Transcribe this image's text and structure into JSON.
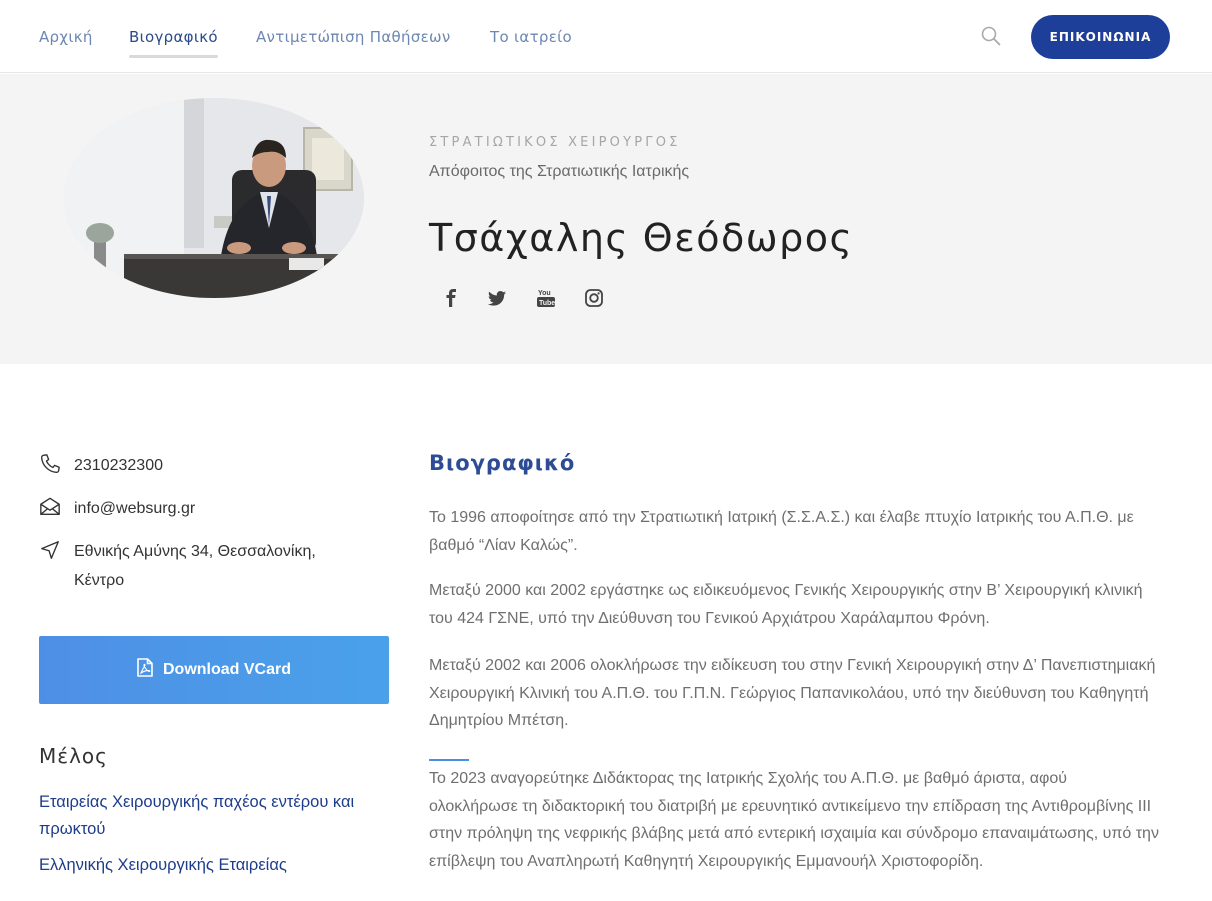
{
  "nav": {
    "items": [
      {
        "label": "Αρχική"
      },
      {
        "label": "Βιογραφικό",
        "active": true
      },
      {
        "label": "Αντιμετώπιση Παθήσεων"
      },
      {
        "label": "Το ιατρείο"
      }
    ],
    "search_icon": "search-icon",
    "contact_label": "ΕΠΙΚΟΙΝΩΝΙΑ",
    "contact_color": "#1d3e99"
  },
  "hero": {
    "portrait_alt": "portrait",
    "caps_subtitle": "ΣΤΡΑΤΙΩΤΙΚΟΣ ΧΕΙΡΟΥΡΓΟΣ",
    "subtitle": "Απόφοιτος της Στρατιωτικής Ιατρικής",
    "name": "Τσάχαλης Θεόδωρος",
    "social": [
      "facebook-icon",
      "twitter-icon",
      "youtube-icon",
      "instagram-icon"
    ]
  },
  "contact": {
    "phone": "2310232300",
    "email": "info@websurg.gr",
    "address": "Εθνικής Αμύνης 34, Θεσσαλονίκη, Κέντρο"
  },
  "vcard": {
    "label": "Download VCard",
    "color_start": "#4e8fe6",
    "color_end": "#4aa1ea"
  },
  "members": {
    "title": "Μέλος",
    "links": [
      "Εταιρείας Χειρουργικής παχέος εντέρου και πρωκτού",
      "Ελληνικής Χειρουργικής Εταιρείας"
    ]
  },
  "bio": {
    "title": "Βιογραφικό",
    "paragraphs": [
      "Το 1996 αποφοίτησε από την Στρατιωτική Ιατρική (Σ.Σ.Α.Σ.) και έλαβε πτυχίο Ιατρικής του Α.Π.Θ. με βαθμό “Λίαν Καλώς”.",
      "Μεταξύ 2000 και 2002 εργάστηκε ως ειδικευόμενος Γενικής Χειρουργικής στην Β’ Χειρουργική κλινική του 424 ΓΣΝΕ, υπό την Διεύθυνση του Γενικού Αρχιάτρου Χαράλαμπου Φρόνη.",
      "Μεταξύ 2002 και 2006 ολοκλήρωσε την ειδίκευση του στην Γενική Χειρουργική στην Δ’ Πανεπιστημιακή Χειρουργική Κλινική του Α.Π.Θ. του Γ.Π.Ν. Γεώργιος Παπανικολάου, υπό την διεύθυνση του Καθηγητή Δημητρίου Μπέτση.",
      "Το 2023 αναγορεύτηκε Διδάκτορας της Ιατρικής Σχολής του Α.Π.Θ. με βαθμό άριστα, αφού ολοκλήρωσε τη διδακτορική του διατριβή με ερευνητικό αντικείμενο την επίδραση της Αντιθρομβίνης ΙΙΙ στην πρόληψη της νεφρικής βλάβης μετά από εντερική ισχαιμία και σύνδρομο επαναιμάτωσης, υπό την επίβλεψη του Αναπληρωτή Καθηγητή Χειρουργικής Εμμανουήλ Χριστοφορίδη."
    ]
  }
}
